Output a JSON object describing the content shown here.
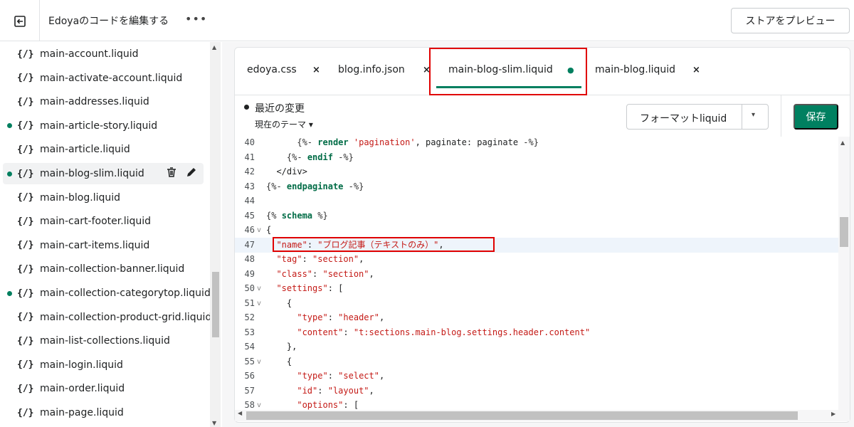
{
  "topbar": {
    "title": "Edoyaのコードを編集する",
    "more": "•••",
    "preview_label": "ストアをプレビュー"
  },
  "sidebar": {
    "files": [
      {
        "name": "main-account.liquid",
        "modified": false
      },
      {
        "name": "main-activate-account.liquid",
        "modified": false
      },
      {
        "name": "main-addresses.liquid",
        "modified": false
      },
      {
        "name": "main-article-story.liquid",
        "modified": true
      },
      {
        "name": "main-article.liquid",
        "modified": false
      },
      {
        "name": "main-blog-slim.liquid",
        "modified": true,
        "active": true
      },
      {
        "name": "main-blog.liquid",
        "modified": false
      },
      {
        "name": "main-cart-footer.liquid",
        "modified": false
      },
      {
        "name": "main-cart-items.liquid",
        "modified": false
      },
      {
        "name": "main-collection-banner.liquid",
        "modified": false
      },
      {
        "name": "main-collection-categorytop.liquid",
        "modified": true
      },
      {
        "name": "main-collection-product-grid.liquid",
        "modified": false
      },
      {
        "name": "main-list-collections.liquid",
        "modified": false
      },
      {
        "name": "main-login.liquid",
        "modified": false
      },
      {
        "name": "main-order.liquid",
        "modified": false
      },
      {
        "name": "main-page.liquid",
        "modified": false
      }
    ],
    "file_icon": "{/}"
  },
  "tabs": [
    {
      "label": "edoya.css",
      "close": "×"
    },
    {
      "label": "blog.info.json",
      "close": "×"
    },
    {
      "label": "main-blog-slim.liquid",
      "close": "●"
    },
    {
      "label": "main-blog.liquid",
      "close": "×"
    }
  ],
  "editor": {
    "recent_changes": "最近の変更",
    "theme_select": "現在のテーマ ▾",
    "format_label": "フォーマットliquid",
    "format_caret": "▾",
    "save_label": "保存",
    "current_line": 47,
    "lines": [
      {
        "n": "40",
        "html": "      <span class=\"p\">{%-</span> <span class=\"k\">render</span> <span class=\"s\">'pagination'</span>, paginate: paginate <span class=\"p\">-%}</span>"
      },
      {
        "n": "41",
        "html": "    <span class=\"p\">{%-</span> <span class=\"k\">endif</span> <span class=\"p\">-%}</span>"
      },
      {
        "n": "42",
        "html": "  &lt;/div&gt;"
      },
      {
        "n": "43",
        "html": "<span class=\"p\">{%-</span> <span class=\"k\">endpaginate</span> <span class=\"p\">-%}</span>"
      },
      {
        "n": "44",
        "html": ""
      },
      {
        "n": "45",
        "html": "<span class=\"p\">{%</span> <span class=\"k\">schema</span> <span class=\"p\">%}</span>"
      },
      {
        "n": "46",
        "html": "{",
        "fold": true
      },
      {
        "n": "47",
        "html": "  <span class=\"s\">\"name\"</span>: <span class=\"s\">\"ブログ記事（テキストのみ）\"</span>,"
      },
      {
        "n": "48",
        "html": "  <span class=\"s\">\"tag\"</span>: <span class=\"s\">\"section\"</span>,"
      },
      {
        "n": "49",
        "html": "  <span class=\"s\">\"class\"</span>: <span class=\"s\">\"section\"</span>,"
      },
      {
        "n": "50",
        "html": "  <span class=\"s\">\"settings\"</span>: [",
        "fold": true
      },
      {
        "n": "51",
        "html": "    {",
        "fold": true
      },
      {
        "n": "52",
        "html": "      <span class=\"s\">\"type\"</span>: <span class=\"s\">\"header\"</span>,"
      },
      {
        "n": "53",
        "html": "      <span class=\"s\">\"content\"</span>: <span class=\"s\">\"t:sections.main-blog.settings.header.content\"</span>"
      },
      {
        "n": "54",
        "html": "    },"
      },
      {
        "n": "55",
        "html": "    {",
        "fold": true
      },
      {
        "n": "56",
        "html": "      <span class=\"s\">\"type\"</span>: <span class=\"s\">\"select\"</span>,"
      },
      {
        "n": "57",
        "html": "      <span class=\"s\">\"id\"</span>: <span class=\"s\">\"layout\"</span>,"
      },
      {
        "n": "58",
        "html": "      <span class=\"s\">\"options\"</span>: [",
        "fold": true
      }
    ]
  },
  "colors": {
    "accent": "#008060",
    "highlight": "#e00000"
  }
}
